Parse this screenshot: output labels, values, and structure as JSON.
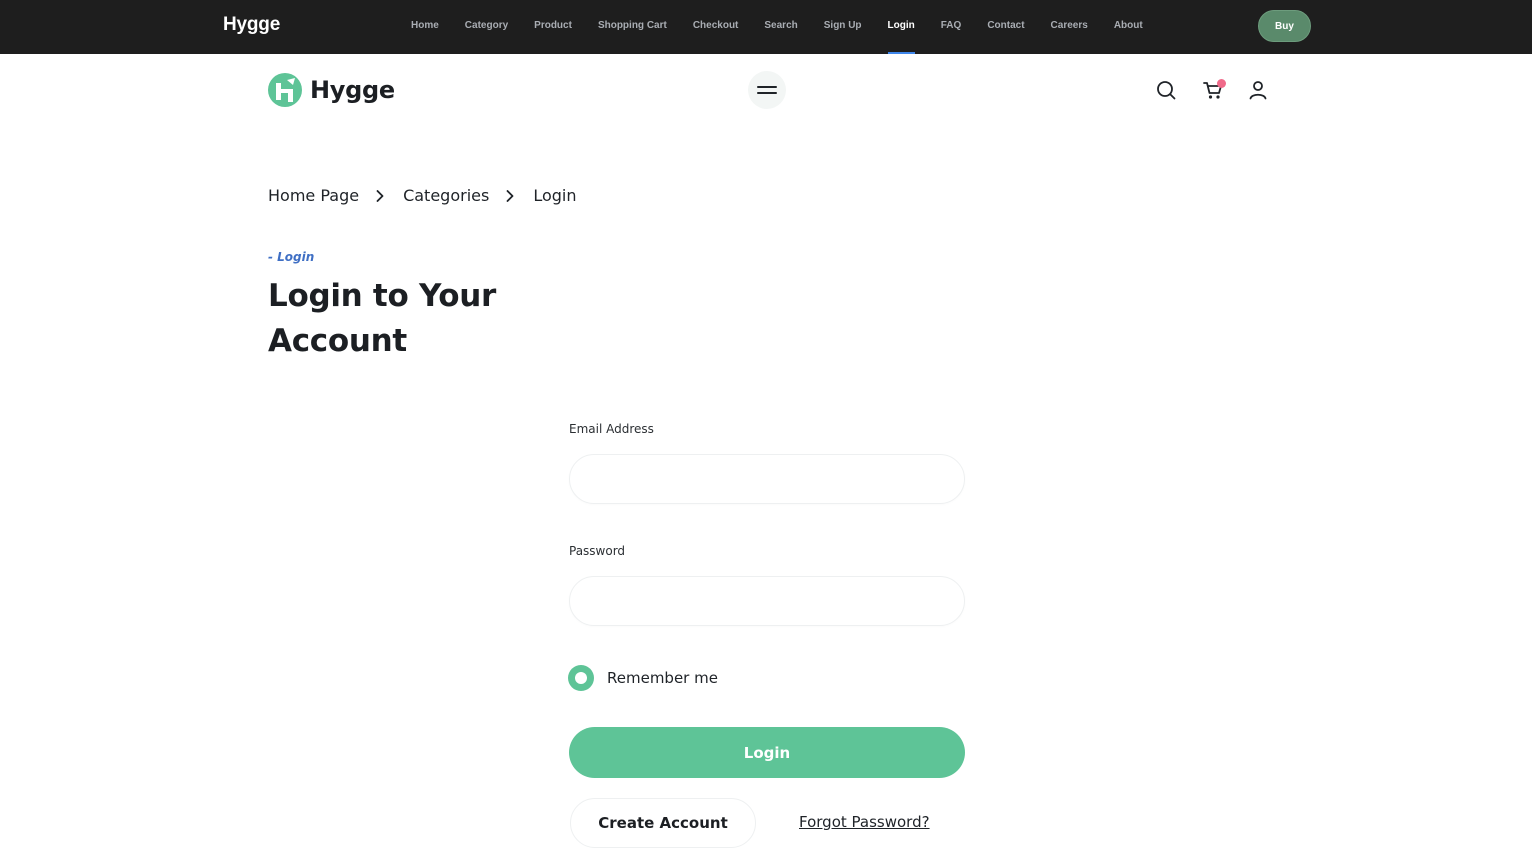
{
  "topbar": {
    "brand": "Hygge",
    "nav": [
      "Home",
      "Category",
      "Product",
      "Shopping Cart",
      "Checkout",
      "Search",
      "Sign Up",
      "Login",
      "FAQ",
      "Contact",
      "Careers",
      "About"
    ],
    "active": "Login",
    "buy_label": "Buy"
  },
  "header": {
    "logo_text": "Hygge",
    "icons": [
      "menu-icon",
      "search-icon",
      "cart-icon",
      "user-icon"
    ],
    "cart_badge_color": "#f06a8a"
  },
  "breadcrumb": [
    "Home Page",
    "Categories",
    "Login"
  ],
  "page": {
    "eyebrow": "- Login",
    "title": "Login to Your Account"
  },
  "form": {
    "email_label": "Email Address",
    "email_value": "",
    "password_label": "Password",
    "password_value": "",
    "remember_label": "Remember me",
    "login_label": "Login",
    "create_account_label": "Create Account",
    "forgot_label": "Forgot Password?"
  },
  "colors": {
    "accent": "#5ec497",
    "topbar_bg": "#1e1e1e",
    "buy_bg": "#5a8a6b",
    "active_underline": "#3f86ea",
    "eyebrow": "#3f6fc4"
  }
}
